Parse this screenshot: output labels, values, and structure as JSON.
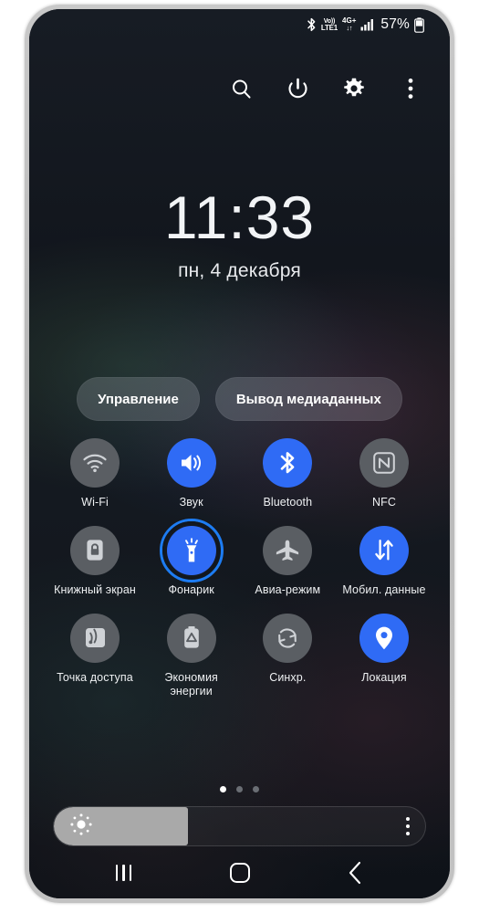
{
  "statusbar": {
    "bluetooth_icon": "bluetooth-icon",
    "volte_line1": "Vo))",
    "volte_line2": "LTE1",
    "network_label": "4G+",
    "network_arrows": "↓↑",
    "signal_icon": "signal-bars-icon",
    "battery_percent": "57%",
    "battery_icon": "battery-icon"
  },
  "quick_header": {
    "search": "search-icon",
    "power": "power-icon",
    "settings": "gear-icon",
    "more": "more-vertical-icon"
  },
  "lockscreen": {
    "time": "11:33",
    "date": "пн, 4 декабря"
  },
  "pills": [
    {
      "label": "Управление",
      "name": "control-pill"
    },
    {
      "label": "Вывод медиаданных",
      "name": "media-output-pill"
    }
  ],
  "colors": {
    "accent_on": "#2f6bf5",
    "tile_off": "#5a5e63",
    "ring_highlight": "#1d7cf2",
    "slider_fill": "#a9a9a9",
    "screen_bg": "#151a21",
    "bezel": "#c2c2c2"
  },
  "toggles": {
    "rows": [
      [
        {
          "label": "Wi-Fi",
          "state": "off",
          "icon": "wifi-icon",
          "highlighted": false
        },
        {
          "label": "Звук",
          "state": "on",
          "icon": "sound-icon",
          "highlighted": false
        },
        {
          "label": "Bluetooth",
          "state": "on",
          "icon": "bluetooth-icon",
          "highlighted": false
        },
        {
          "label": "NFC",
          "state": "off",
          "icon": "nfc-icon",
          "highlighted": false
        }
      ],
      [
        {
          "label": "Книжный экран",
          "state": "off",
          "icon": "rotation-lock-icon",
          "highlighted": false
        },
        {
          "label": "Фонарик",
          "state": "on",
          "icon": "flashlight-icon",
          "highlighted": true
        },
        {
          "label": "Авиа-режим",
          "state": "off",
          "icon": "airplane-icon",
          "highlighted": false
        },
        {
          "label": "Мобил. данные",
          "state": "on",
          "icon": "mobile-data-icon",
          "highlighted": false
        }
      ],
      [
        {
          "label": "Точка доступа",
          "state": "off",
          "icon": "hotspot-icon",
          "highlighted": false
        },
        {
          "label": "Экономия энергии",
          "state": "off",
          "icon": "power-saving-icon",
          "highlighted": false
        },
        {
          "label": "Синхр.",
          "state": "off",
          "icon": "sync-icon",
          "highlighted": false
        },
        {
          "label": "Локация",
          "state": "on",
          "icon": "location-pin-icon",
          "highlighted": false
        }
      ]
    ]
  },
  "pager": {
    "total": 3,
    "active_index": 0
  },
  "brightness": {
    "value_percent": 36,
    "icon": "brightness-sun-icon",
    "menu_icon": "more-vertical-icon"
  },
  "navbar": {
    "recents": "recents-icon",
    "home": "home-icon",
    "back": "back-icon"
  }
}
